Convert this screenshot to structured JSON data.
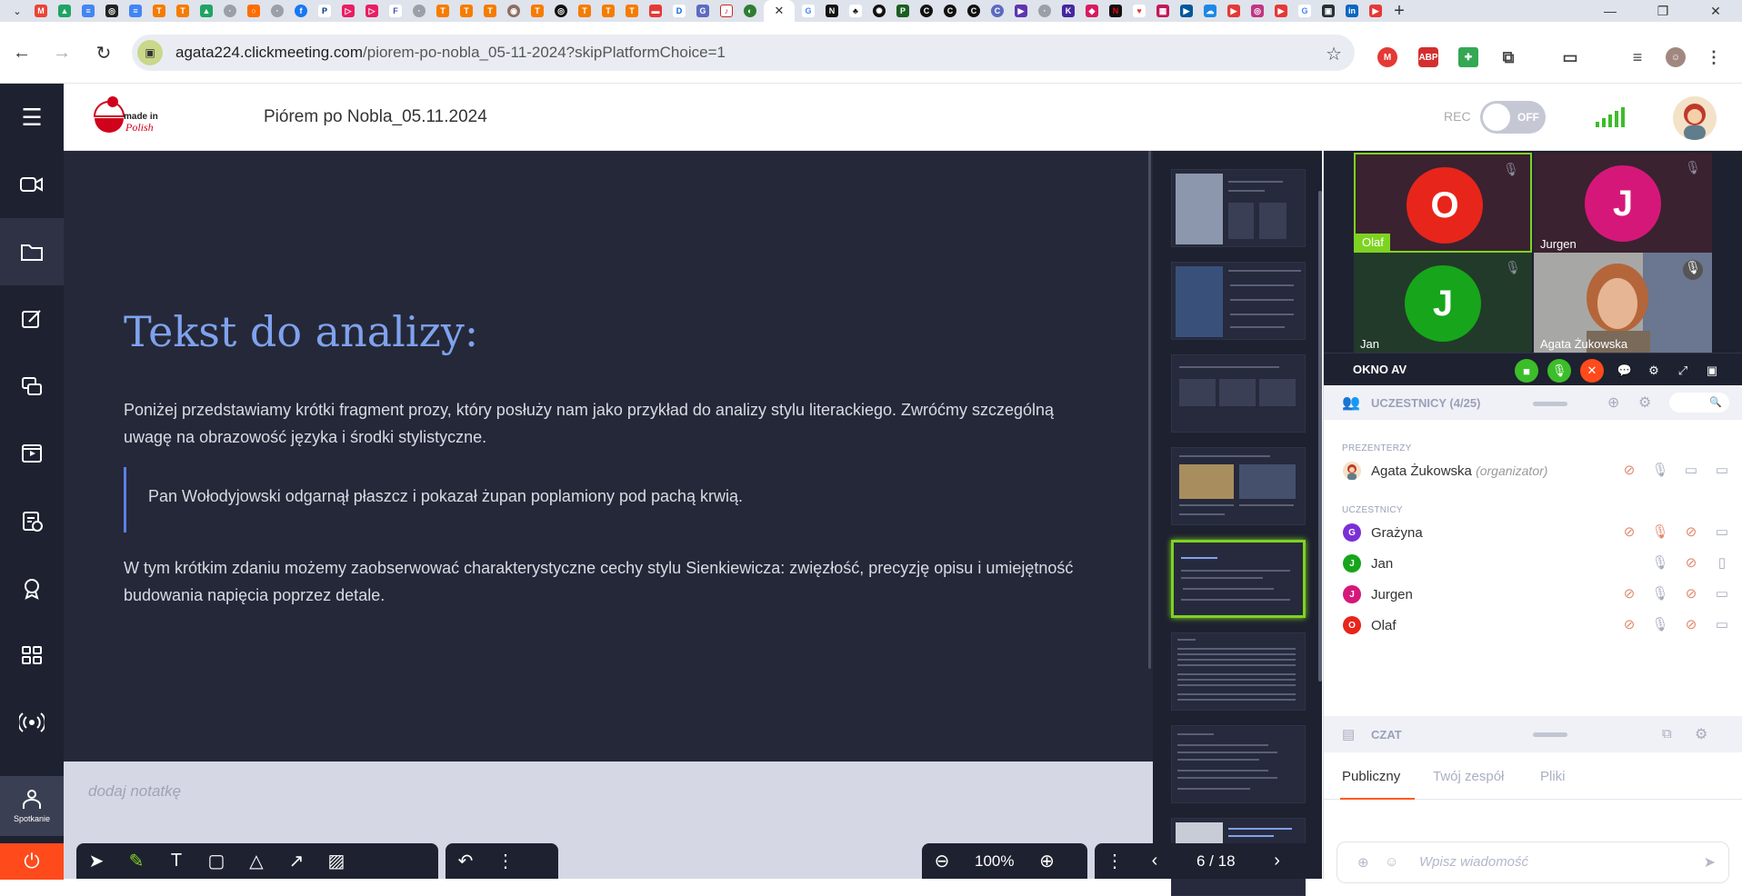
{
  "browser": {
    "url_domain": "agata224.clickmeeting.com",
    "url_path": "/piorem-po-nobla_05-11-2024?skipPlatformChoice=1",
    "tab_close": "✕",
    "new_tab": "+",
    "window_minimize": "—",
    "window_restore": "❐",
    "window_close": "✕"
  },
  "app": {
    "meeting_title": "Piórem po Nobla_05.11.2024",
    "logo_text": "made in Polish",
    "rec_label": "REC",
    "rec_toggle": "OFF"
  },
  "sidebar": {
    "spotkanie_label": "Spotkanie"
  },
  "slide": {
    "title": "Tekst do analizy:",
    "paragraph1": "Poniżej przedstawiamy krótki fragment prozy, który posłuży nam jako przykład do analizy stylu literackiego. Zwróćmy szczególną uwagę na obrazowość języka i środki stylistyczne.",
    "quote": "Pan Wołodyjowski odgarnął płaszcz i pokazał żupan poplamiony pod pachą krwią.",
    "paragraph2": "W tym krótkim zdaniu możemy zaobserwować charakterystyczne cechy stylu Sienkiewicza: zwięzłość, precyzję opisu i umiejętność budowania napięcia poprzez detale."
  },
  "notes": {
    "placeholder": "dodaj notatkę"
  },
  "toolbar": {
    "zoom": "100%",
    "page_indicator": "6 / 18"
  },
  "video": {
    "tiles": [
      {
        "initial": "O",
        "name": "Olaf",
        "color": "#e8251b"
      },
      {
        "initial": "J",
        "name": "Jurgen",
        "color": "#d6177a"
      },
      {
        "initial": "J",
        "name": "Jan",
        "color": "#17a51b"
      },
      {
        "initial": "",
        "name": "Agata Żukowska",
        "color": "#8a8170"
      }
    ],
    "av_label": "OKNO AV"
  },
  "participants": {
    "header": "UCZESTNICY (4/25)",
    "search_icon": "🔍",
    "presenters_label": "PREZENTERZY",
    "attendees_label": "UCZESTNICY",
    "presenter": {
      "name": "Agata Żukowska",
      "role": "(organizator)"
    },
    "attendees": [
      {
        "initial": "G",
        "name": "Grażyna",
        "color": "#7b2fd6"
      },
      {
        "initial": "J",
        "name": "Jan",
        "color": "#17a51b"
      },
      {
        "initial": "J",
        "name": "Jurgen",
        "color": "#d6177a"
      },
      {
        "initial": "O",
        "name": "Olaf",
        "color": "#e8251b"
      }
    ]
  },
  "chat": {
    "header": "CZAT",
    "tabs": [
      "Publiczny",
      "Twój zespół",
      "Pliki"
    ],
    "input_placeholder": "Wpisz wiadomość"
  }
}
